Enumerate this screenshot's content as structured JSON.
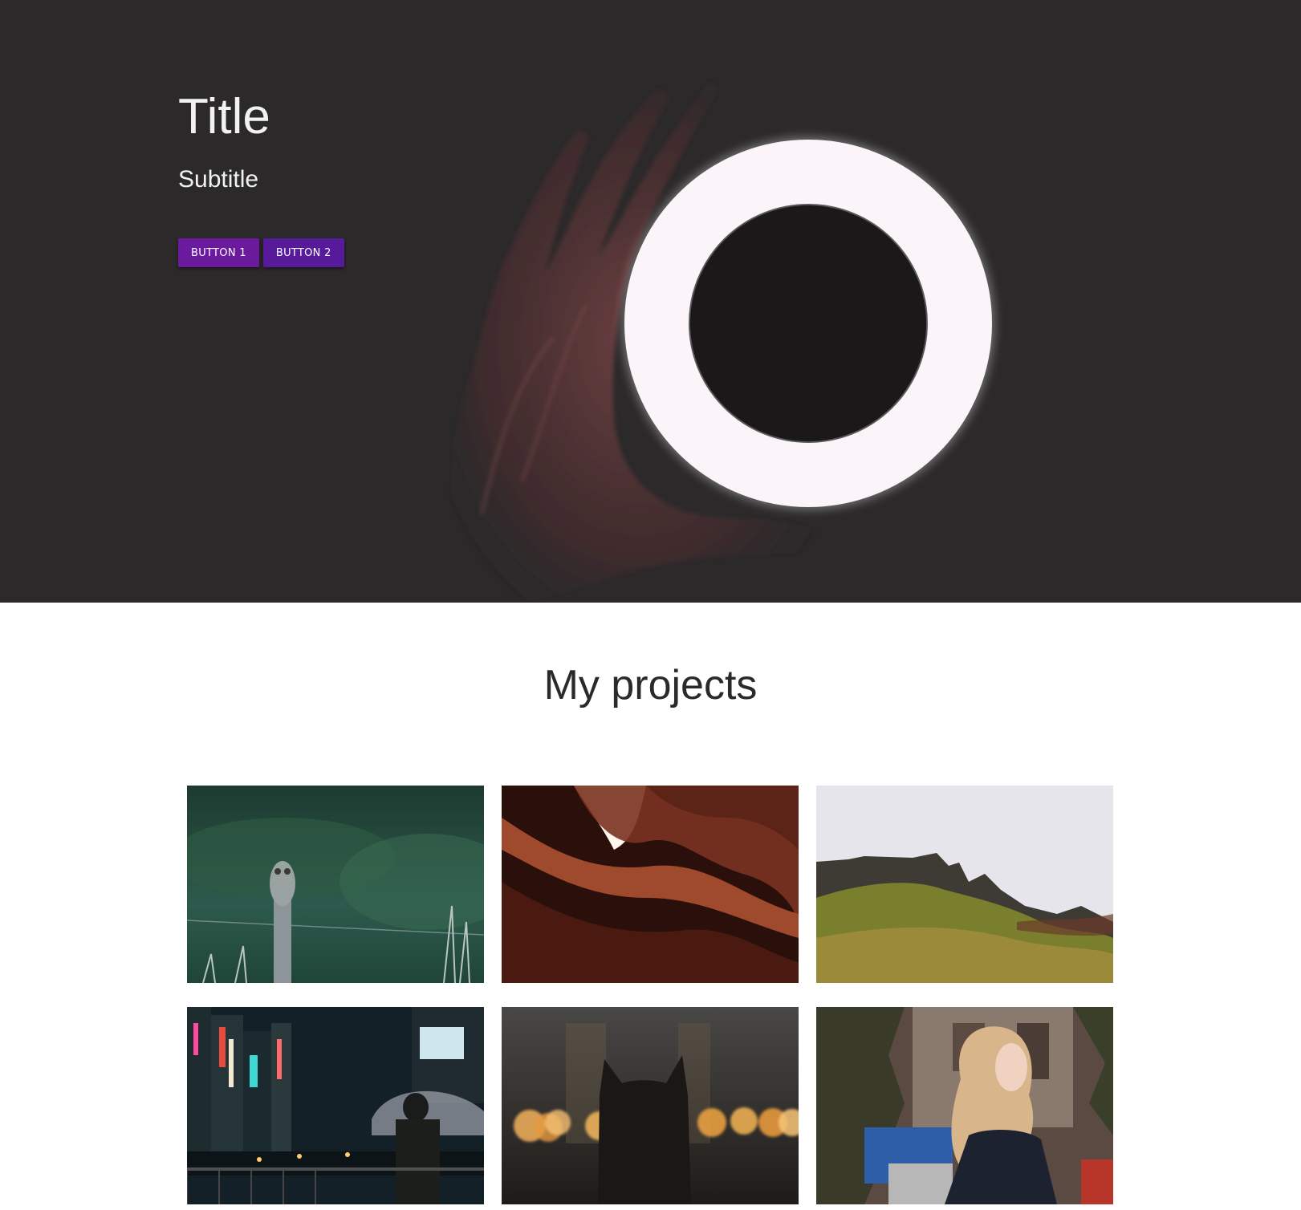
{
  "hero": {
    "title": "Title",
    "subtitle": "Subtitle",
    "buttons": [
      "BUTTON 1",
      "BUTTON 2"
    ],
    "background_color": "#2b292a",
    "button_color": "#6b1a9e",
    "image": "hand-holding-glowing-ring-light"
  },
  "projects": {
    "heading": "My projects",
    "items": [
      "owl-on-fence-post",
      "red-sandstone-canyon",
      "green-mountain-ridge",
      "neon-city-street-at-night",
      "cat-silhouette-with-bokeh-lights",
      "woman-with-blonde-hair-portrait"
    ]
  }
}
